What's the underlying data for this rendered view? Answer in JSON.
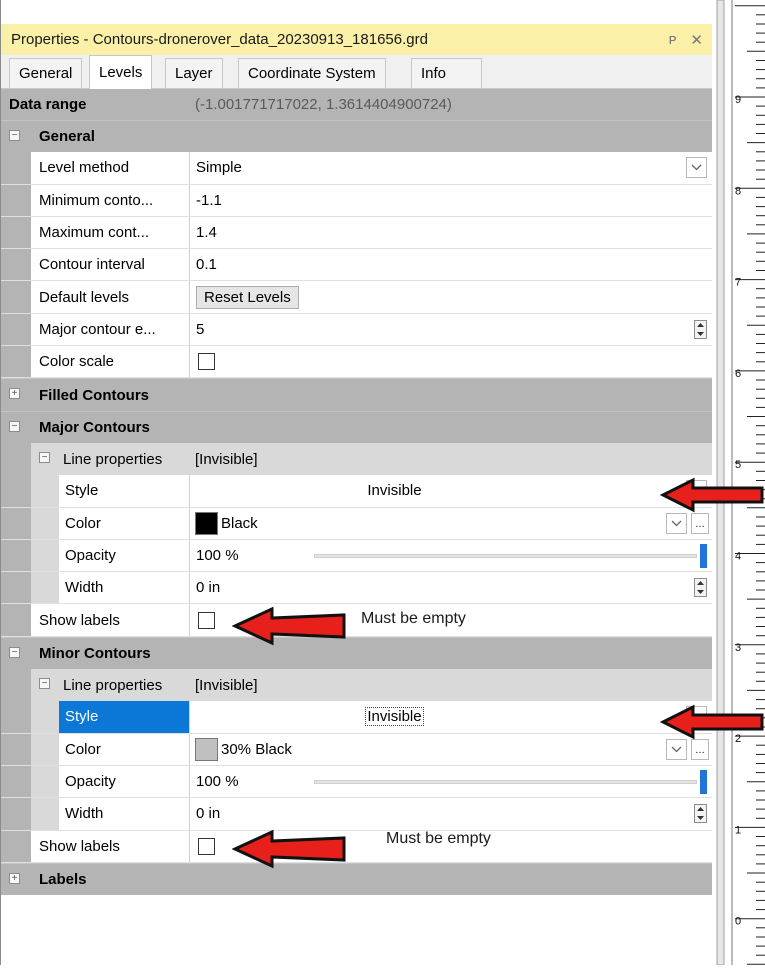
{
  "window": {
    "title": "Properties - Contours-dronerover_data_20230913_181656.grd",
    "pin_icon": "pin-icon",
    "close_icon": "close-icon"
  },
  "tabs": [
    {
      "label": "General"
    },
    {
      "label": "Levels",
      "active": true
    },
    {
      "label": "Layer"
    },
    {
      "label": "Coordinate System"
    },
    {
      "label": "Info"
    }
  ],
  "data_range": {
    "label": "Data range",
    "value": "(-1.001771717022, 1.3614404900724)"
  },
  "general": {
    "label": "General",
    "level_method": {
      "label": "Level method",
      "value": "Simple"
    },
    "min_contour": {
      "label": "Minimum conto...",
      "value": "-1.1"
    },
    "max_contour": {
      "label": "Maximum cont...",
      "value": "1.4"
    },
    "interval": {
      "label": "Contour interval",
      "value": "0.1"
    },
    "default_levels": {
      "label": "Default levels",
      "button": "Reset Levels"
    },
    "major_every": {
      "label": "Major contour e...",
      "value": "5"
    },
    "color_scale": {
      "label": "Color scale",
      "checked": false
    }
  },
  "filled": {
    "label": "Filled Contours"
  },
  "major": {
    "label": "Major Contours",
    "line_properties": {
      "label": "Line properties",
      "value": "[Invisible]"
    },
    "style": {
      "label": "Style",
      "value": "Invisible"
    },
    "color": {
      "label": "Color",
      "value": "Black",
      "swatch": "#000000"
    },
    "opacity": {
      "label": "Opacity",
      "value": "100 %",
      "level": 1.0
    },
    "width": {
      "label": "Width",
      "value": "0 in"
    },
    "show_labels": {
      "label": "Show labels",
      "checked": false
    }
  },
  "minor": {
    "label": "Minor Contours",
    "line_properties": {
      "label": "Line properties",
      "value": "[Invisible]"
    },
    "style": {
      "label": "Style",
      "value": "Invisible"
    },
    "color": {
      "label": "Color",
      "value": "30% Black",
      "swatch": "#c0c0c0"
    },
    "opacity": {
      "label": "Opacity",
      "value": "100 %",
      "level": 1.0
    },
    "width": {
      "label": "Width",
      "value": "0 in"
    },
    "show_labels": {
      "label": "Show labels",
      "checked": false
    }
  },
  "labels": {
    "label": "Labels"
  },
  "annotations": {
    "note_1": "Must be empty",
    "note_2": "Must be empty",
    "arrow_color": "#e8201c"
  },
  "ruler": {
    "ticks": [
      "9",
      "8",
      "7",
      "6",
      "5",
      "4",
      "3",
      "2",
      "1",
      "0"
    ]
  },
  "colors": {
    "title_bar": "#fbf0a8",
    "section_bg": "#b4b4b4",
    "selection": "#0b78d8"
  }
}
